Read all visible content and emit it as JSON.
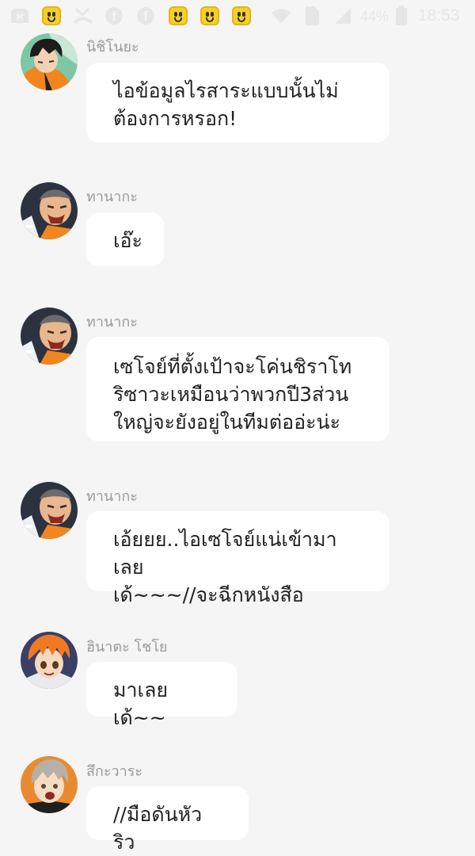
{
  "status_bar": {
    "battery_percent": "44%",
    "time": "18:53",
    "icons": [
      "image-icon",
      "emoji-icon",
      "missed-call-icon",
      "facebook-icon",
      "facebook-icon",
      "emoji-icon",
      "emoji-icon",
      "emoji-icon",
      "wifi-icon",
      "sim-icon",
      "signal-icon",
      "battery-icon"
    ]
  },
  "chat": {
    "messages": [
      {
        "sender": "นิชิโนยะ",
        "text": "ไอข้อมูลไรสาระแบบนั้นไม่\nต้องการหรอก!"
      },
      {
        "sender": "ทานากะ",
        "text": "เอ๊ะ"
      },
      {
        "sender": "ทานากะ",
        "text": "เซโจย์ที่ตั้งเป้าจะโค่นชิราโท\nริซาวะเหมือนว่าพวกปี3ส่วน\nใหญ่จะยังอยู่ในทีมต่ออ่ะน่ะ"
      },
      {
        "sender": "ทานากะ",
        "text": "เอ้ยยย..ไอเซโจย์แน่เข้ามาเลย\nเด้~~~//จะฉีกหนังสือ"
      },
      {
        "sender": "ฮินาตะ โชโย",
        "text": "มาเลยเด้~~"
      },
      {
        "sender": "สึกะวาระ",
        "text": "//มือดันหัว ริว"
      }
    ]
  },
  "colors": {
    "background": "#f5f5f5",
    "bubble": "#ffffff",
    "sender_name": "#9a9a9a",
    "message_text": "#222222"
  }
}
